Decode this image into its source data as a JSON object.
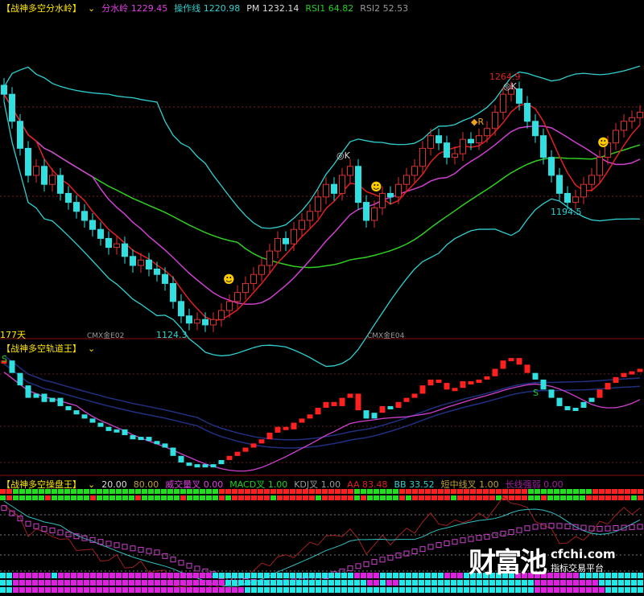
{
  "top_panel": {
    "title": "【战神多空分水岭】",
    "dropdown": "⌄",
    "fsl_label": "分水岭",
    "fsl": "1229.45",
    "czx_label": "操作线",
    "czx": "1220.98",
    "pm_label": "PM",
    "pm": "1232.14",
    "rsi1_label": "RSI1",
    "rsi1": "64.82",
    "rsi2_label": "RSI2",
    "rsi2": "52.53",
    "days": "177天",
    "contract1": "CMX金E02",
    "contract2": "CMX金E04",
    "high": "1264.9",
    "low": "1124.3",
    "low2": "1194.5",
    "mark_k": "◎K",
    "mark_r": "R"
  },
  "mid_panel": {
    "title": "【战神多空轨道王】",
    "dropdown": "⌄",
    "mark_s": "S"
  },
  "bottom_panel": {
    "title": "【战神多空操盘王】",
    "dropdown": "⌄",
    "v1": "20.00",
    "v2": "80.00",
    "wjl_label": "威交量叉",
    "wjl": "0.00",
    "macd_label": "MACD叉",
    "macd": "1.00",
    "kdj_label": "KDJ叉",
    "kdj": "1.00",
    "aa_label": "AA",
    "aa": "83.48",
    "bb_label": "BB",
    "bb": "33.52",
    "dzx_label": "短中线叉",
    "dzx": "1.00",
    "cxqr_label": "长线强弱",
    "cxqr": "0.00"
  },
  "watermark": {
    "brand": "财富池",
    "site": "cfchi.com",
    "tagline": "指标交易平台"
  },
  "chart_data": {
    "type": "candlestick",
    "title": "CMX金",
    "ylim": [
      1124.3,
      1264.9
    ],
    "closes": [
      1255,
      1240,
      1225,
      1210,
      1215,
      1205,
      1210,
      1200,
      1195,
      1190,
      1185,
      1180,
      1175,
      1170,
      1172,
      1165,
      1160,
      1163,
      1158,
      1155,
      1150,
      1140,
      1132,
      1128,
      1130,
      1127,
      1130,
      1135,
      1140,
      1145,
      1150,
      1155,
      1160,
      1168,
      1175,
      1172,
      1180,
      1185,
      1190,
      1198,
      1205,
      1200,
      1210,
      1215,
      1195,
      1185,
      1192,
      1200,
      1198,
      1205,
      1210,
      1215,
      1225,
      1232,
      1228,
      1220,
      1222,
      1230,
      1228,
      1232,
      1236,
      1245,
      1255,
      1258,
      1250,
      1240,
      1232,
      1220,
      1210,
      1200,
      1195,
      1198,
      1205,
      1210,
      1220,
      1228,
      1235,
      1240,
      1242,
      1245
    ]
  }
}
